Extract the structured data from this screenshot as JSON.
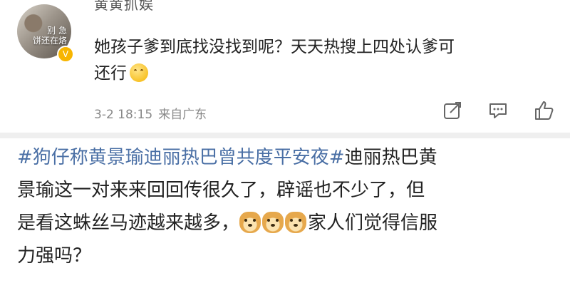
{
  "comment": {
    "username": "黄黄抓娱",
    "avatar_overlay_line1": "别 急",
    "avatar_overlay_line2": "饼还在烙",
    "text_line1": "她孩子爹到底找没找到呢？天天热搜上四处认爹可",
    "text_line2": "还行",
    "emoji": "smile-emoji",
    "timestamp": "3-2 18:15",
    "location": "来自广东",
    "actions": [
      "share-icon",
      "comment-icon",
      "like-icon"
    ]
  },
  "post": {
    "hashtag1": "#狗仔称黄景瑜迪丽热巴曾共度平安夜#",
    "hashtag2": "迪丽热巴黄",
    "line2": "景瑜这一对来来回回传很久了，辟谣也不少了，但",
    "line3": "是看这蛛丝马迹越来越多，",
    "line3_tail": "家人们觉得信服",
    "line4": "力强吗？",
    "emoji_count": 3,
    "emoji_name": "doge-emoji"
  },
  "colors": {
    "hashtag": "#4a6fa5",
    "meta": "#888888",
    "badge": "#f7b500"
  }
}
